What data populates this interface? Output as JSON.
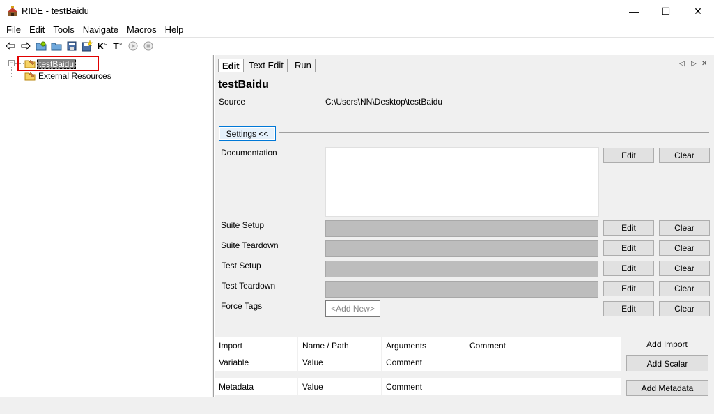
{
  "window": {
    "title": "RIDE - testBaidu",
    "minimize_glyph": "—",
    "maximize_glyph": "☐",
    "close_glyph": "✕"
  },
  "menu": [
    "File",
    "Edit",
    "Tools",
    "Navigate",
    "Macros",
    "Help"
  ],
  "toolbar": {
    "icons": [
      "back-icon",
      "forward-icon",
      "open-suite-icon",
      "open-directory-icon",
      "save-icon",
      "save-all-icon",
      "search-keywords-icon",
      "search-tests-icon",
      "run-icon",
      "stop-icon"
    ],
    "keyword_glyph": "K",
    "test_glyph": "T"
  },
  "tree": {
    "expander": "−",
    "root_label": "testBaidu",
    "child_label": "External Resources"
  },
  "tabs": [
    {
      "label": "Edit",
      "active": true
    },
    {
      "label": "Text Edit",
      "active": false
    },
    {
      "label": "Run",
      "active": false
    }
  ],
  "tab_nav": {
    "prev": "◁",
    "next": "▷",
    "close": "✕"
  },
  "editor": {
    "suite_name": "testBaidu",
    "source_label": "Source",
    "source_value": "C:\\Users\\NN\\Desktop\\testBaidu",
    "settings_toggle": "Settings <<",
    "settings": {
      "documentation": "Documentation",
      "suite_setup": "Suite Setup",
      "suite_teardown": "Suite Teardown",
      "test_setup": "Test Setup",
      "test_teardown": "Test Teardown",
      "force_tags": "Force Tags",
      "add_new_tag": "<Add New>"
    },
    "edit_label": "Edit",
    "clear_label": "Clear"
  },
  "imports_table": {
    "headers": [
      "Import",
      "Name / Path",
      "Arguments",
      "Comment"
    ],
    "variable_row": [
      "Variable",
      "Value",
      "Comment"
    ],
    "add_import": "Add Import",
    "add_scalar": "Add Scalar"
  },
  "metadata_table": {
    "headers": [
      "Metadata",
      "Value",
      "Comment"
    ],
    "add_metadata": "Add Metadata"
  },
  "colors": {
    "selection_bg": "#808080",
    "highlight_border": "#e00000",
    "field_gray": "#bdbdbd",
    "panel_bg": "#f0f0f0",
    "focus_blue": "#0078d7"
  }
}
